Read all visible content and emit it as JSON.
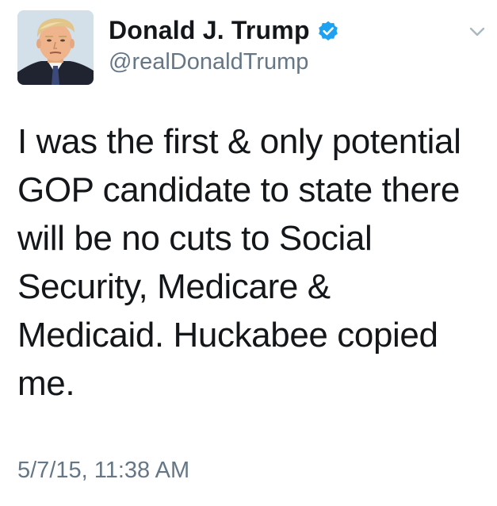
{
  "tweet": {
    "author": {
      "display_name": "Donald J. Trump",
      "handle": "@realDonaldTrump",
      "verified": true,
      "verified_icon": "verified-badge-icon",
      "avatar_icon": "profile-photo"
    },
    "text_lines": [
      "I was the first & only potential",
      "GOP candidate to state there",
      "will be no cuts to Social",
      "Security, Medicare &",
      "Medicaid. Huckabee copied",
      "me."
    ],
    "timestamp": "5/7/15, 11:38 AM",
    "menu_icon": "chevron-down-icon"
  },
  "colors": {
    "text": "#14171a",
    "secondary_text": "#657786",
    "verified_blue": "#1da1f2",
    "caret": "#aab8c2",
    "background": "#ffffff"
  }
}
